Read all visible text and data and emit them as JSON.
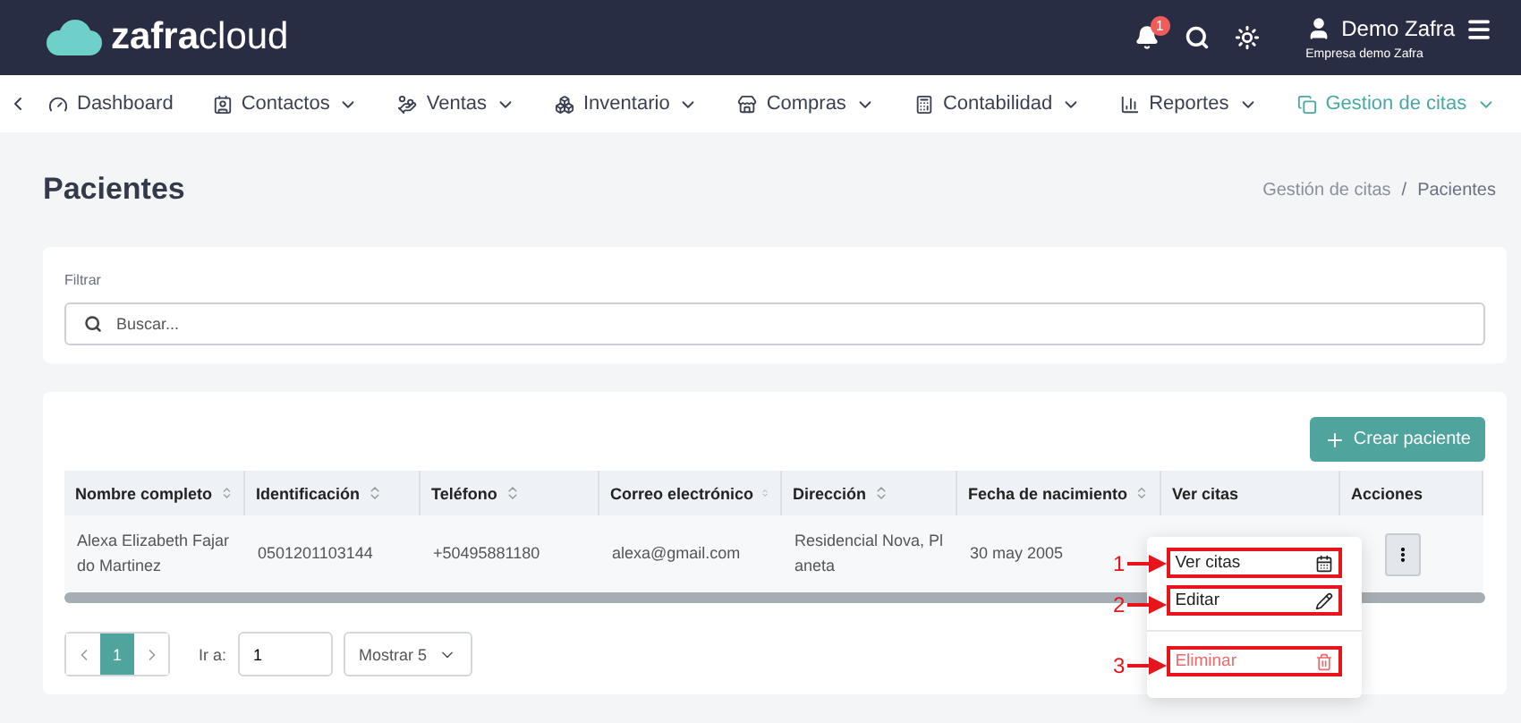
{
  "header": {
    "logo": {
      "bold": "zafra",
      "light": "cloud"
    },
    "notifications": {
      "count": "1"
    },
    "user": {
      "name": "Demo Zafra",
      "company": "Empresa demo Zafra"
    }
  },
  "nav": {
    "items": [
      {
        "label": "Dashboard",
        "dropdown": false,
        "selected": false
      },
      {
        "label": "Contactos",
        "dropdown": true,
        "selected": false
      },
      {
        "label": "Ventas",
        "dropdown": true,
        "selected": false
      },
      {
        "label": "Inventario",
        "dropdown": true,
        "selected": false
      },
      {
        "label": "Compras",
        "dropdown": true,
        "selected": false
      },
      {
        "label": "Contabilidad",
        "dropdown": true,
        "selected": false
      },
      {
        "label": "Reportes",
        "dropdown": true,
        "selected": false
      },
      {
        "label": "Gestion de citas",
        "dropdown": true,
        "selected": true
      }
    ]
  },
  "page": {
    "title": "Pacientes",
    "breadcrumb": [
      {
        "label": "Gestión de citas",
        "current": false
      },
      {
        "label": "Pacientes",
        "current": true
      }
    ],
    "separator": "/"
  },
  "filter": {
    "label": "Filtrar",
    "placeholder": "Buscar..."
  },
  "create_button": "Crear paciente",
  "table": {
    "columns": [
      {
        "label": "Nombre completo",
        "sortable": true
      },
      {
        "label": "Identificación",
        "sortable": true
      },
      {
        "label": "Teléfono",
        "sortable": true
      },
      {
        "label": "Correo electrónico",
        "sortable": true
      },
      {
        "label": "Dirección",
        "sortable": true
      },
      {
        "label": "Fecha de nacimiento",
        "sortable": true
      },
      {
        "label": "Ver citas",
        "sortable": false
      },
      {
        "label": "Acciones",
        "sortable": false
      }
    ],
    "rows": [
      {
        "cells": [
          "Alexa Elizabeth Fajardo Martinez",
          "0501201103144",
          "+50495881180",
          "alexa@gmail.com",
          "Residencial Nova, Planeta",
          "30 may 2005"
        ]
      }
    ]
  },
  "action_menu": {
    "items": [
      {
        "label": "Ver citas",
        "kind": "normal",
        "callout": "1",
        "divider_before": false
      },
      {
        "label": "Editar",
        "kind": "normal",
        "callout": "2",
        "divider_before": false
      },
      {
        "label": "Eliminar",
        "kind": "danger",
        "callout": "3",
        "divider_before": true
      }
    ]
  },
  "pagination": {
    "pages": [
      {
        "label": "1",
        "selected": true
      }
    ],
    "goto_label": "Ir a:",
    "goto_value": "1",
    "page_size": "Mostrar 5"
  }
}
